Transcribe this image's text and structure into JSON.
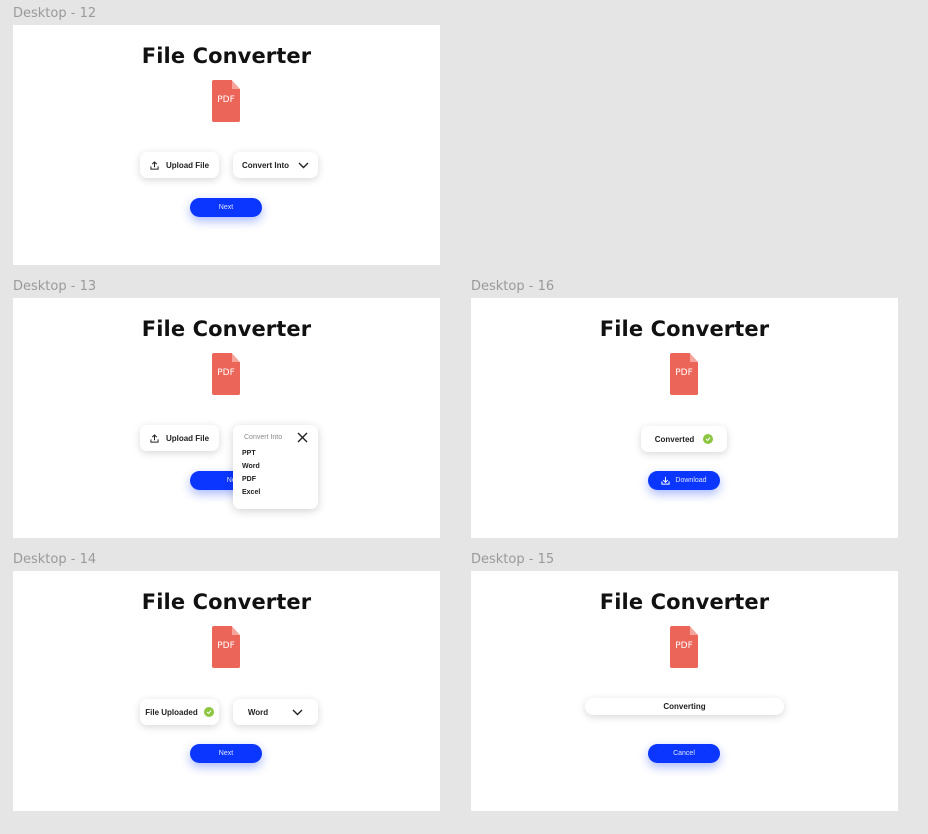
{
  "frames": {
    "d12": {
      "label": "Desktop - 12",
      "title": "File Converter",
      "pdf_label": "PDF",
      "upload": "Upload File",
      "convert": "Convert Into",
      "next": "Next"
    },
    "d13": {
      "label": "Desktop - 13",
      "title": "File Converter",
      "pdf_label": "PDF",
      "upload": "Upload File",
      "next": "Next",
      "dropdown": {
        "header": "Convert Into",
        "options": [
          "PPT",
          "Word",
          "PDF",
          "Excel"
        ]
      }
    },
    "d16": {
      "label": "Desktop - 16",
      "title": "File Converter",
      "pdf_label": "PDF",
      "status": "Converted",
      "download": "Download"
    },
    "d14": {
      "label": "Desktop - 14",
      "title": "File Converter",
      "pdf_label": "PDF",
      "status": "File Uploaded",
      "selected_format": "Word",
      "next": "Next"
    },
    "d15": {
      "label": "Desktop - 15",
      "title": "File Converter",
      "pdf_label": "PDF",
      "progress_text": "Converting",
      "cancel": "Cancel"
    }
  },
  "colors": {
    "accent": "#0a36ff",
    "pdf": "#ec6559",
    "success": "#8cc63f",
    "canvas": "#e5e5e5"
  },
  "icons": [
    "upload-icon",
    "chevron-down-icon",
    "close-icon",
    "check-icon",
    "download-icon",
    "pdf-file-icon"
  ]
}
